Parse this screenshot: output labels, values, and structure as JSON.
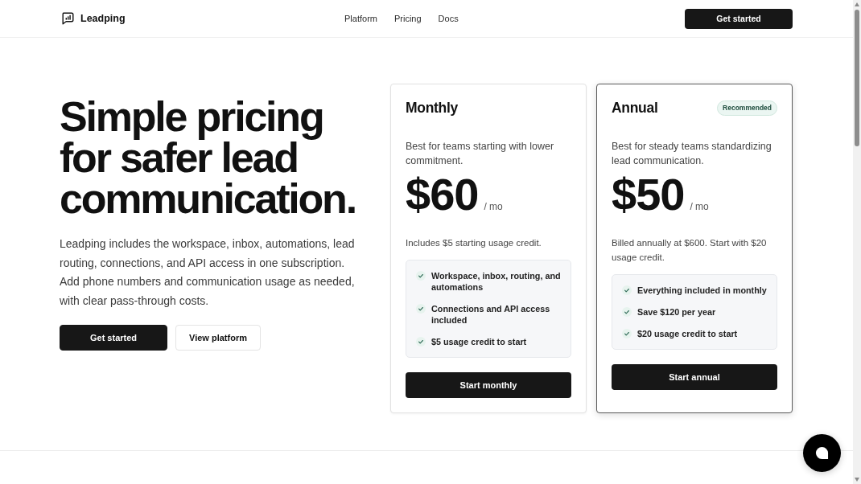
{
  "header": {
    "brand": "Leadping",
    "nav": [
      {
        "label": "Platform"
      },
      {
        "label": "Pricing"
      },
      {
        "label": "Docs"
      }
    ],
    "cta": "Get started"
  },
  "hero": {
    "title": "Simple pricing for safer lead communication.",
    "description": "Leadping includes the workspace, inbox, automations, lead routing, connections, and API access in one subscription. Add phone numbers and communication usage as needed, with clear pass-through costs.",
    "buttons": [
      {
        "label": "Get started",
        "kind": "primary"
      },
      {
        "label": "View platform",
        "kind": "secondary"
      }
    ]
  },
  "plans": [
    {
      "name": "Monthly",
      "featured": false,
      "description": "Best for teams starting with lower commitment.",
      "price": "$60",
      "period": "/ mo",
      "note": "Includes $5 starting usage credit.",
      "features": [
        "Workspace, inbox, routing, and automations",
        "Connections and API access included",
        "$5 usage credit to start"
      ],
      "button": "Start monthly"
    },
    {
      "name": "Annual",
      "badge": "Recommended",
      "featured": true,
      "description": "Best for steady teams standardizing lead communication.",
      "price": "$50",
      "period": "/ mo",
      "note": "Billed annually at $600. Start with $20 usage credit.",
      "features": [
        "Everything included in monthly",
        "Save $120 per year",
        "$20 usage credit to start"
      ],
      "button": "Start annual"
    }
  ]
}
